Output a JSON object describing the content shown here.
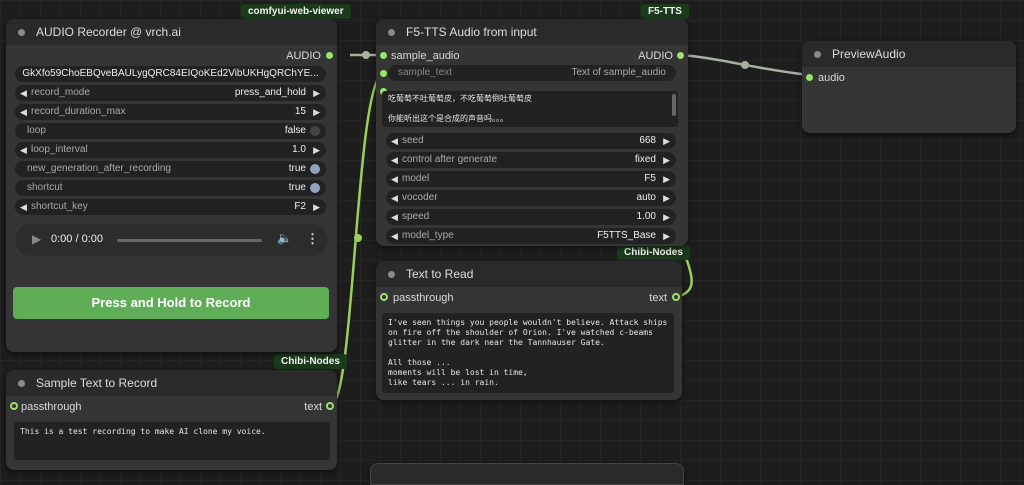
{
  "badges": {
    "recorder": "comfyui-web-viewer",
    "f5tts": "F5-TTS",
    "chibi1": "Chibi-Nodes",
    "chibi2": "Chibi-Nodes"
  },
  "recorder": {
    "title": "AUDIO Recorder @ vrch.ai",
    "output_label": "AUDIO",
    "base64_value": "GkXfo59ChoEBQveBAULygQRC84EIQoKEd2VibUKHgQRChYE...",
    "widgets": [
      {
        "label": "record_mode",
        "value": "press_and_hold"
      },
      {
        "label": "record_duration_max",
        "value": "15"
      }
    ],
    "loop": {
      "label": "loop",
      "value": "false"
    },
    "loop_interval": {
      "label": "loop_interval",
      "value": "1.0"
    },
    "new_generation": {
      "label": "new_generation_after_recording",
      "value": "true"
    },
    "shortcut": {
      "label": "shortcut",
      "value": "true"
    },
    "shortcut_key": {
      "label": "shortcut_key",
      "value": "F2"
    },
    "player_time": "0:00 / 0:00",
    "record_button": "Press and Hold to Record"
  },
  "sample_text": {
    "title": "Sample Text to Record",
    "input_label": "passthrough",
    "output_label": "text",
    "content": "This is a test recording to make AI clone my voice."
  },
  "f5": {
    "title": "F5-TTS Audio from input",
    "input_audio": "sample_audio",
    "input_text": "sample_text",
    "input_text_hint": "Text of sample_audio",
    "output_label": "AUDIO",
    "textarea": "吃葡萄不吐葡萄皮，不吃葡萄倒吐葡萄皮\n\n你能听出这个是合成的声音吗。。。",
    "widgets": [
      {
        "label": "seed",
        "value": "668",
        "arrows": true
      },
      {
        "label": "control after generate",
        "value": "fixed",
        "arrows": false
      },
      {
        "label": "model",
        "value": "F5",
        "arrows": true
      },
      {
        "label": "vocoder",
        "value": "auto",
        "arrows": true
      },
      {
        "label": "speed",
        "value": "1.00",
        "arrows": true
      },
      {
        "label": "model_type",
        "value": "F5TTS_Base",
        "arrows": true
      }
    ]
  },
  "text_to_read": {
    "title": "Text to Read",
    "input_label": "passthrough",
    "output_label": "text",
    "content": "I've seen things you people wouldn't believe. Attack ships\non fire off the shoulder of Orion. I've watched c-beams\nglitter in the dark near the Tannhauser Gate.\n\nAll those ...\nmoments will be lost in time,\nlike tears ... in rain."
  },
  "preview": {
    "title": "PreviewAudio",
    "input_label": "audio"
  },
  "colors": {
    "wire": "#9ccf5a",
    "wire_audio": "#a8b0a0",
    "record_button": "#5fae57",
    "badge_bg": "#1b3a1b"
  },
  "icons": {
    "play": "▶",
    "arrow_left": "◀",
    "arrow_right": "▶",
    "volume": "🔈",
    "menu": "⋮"
  }
}
